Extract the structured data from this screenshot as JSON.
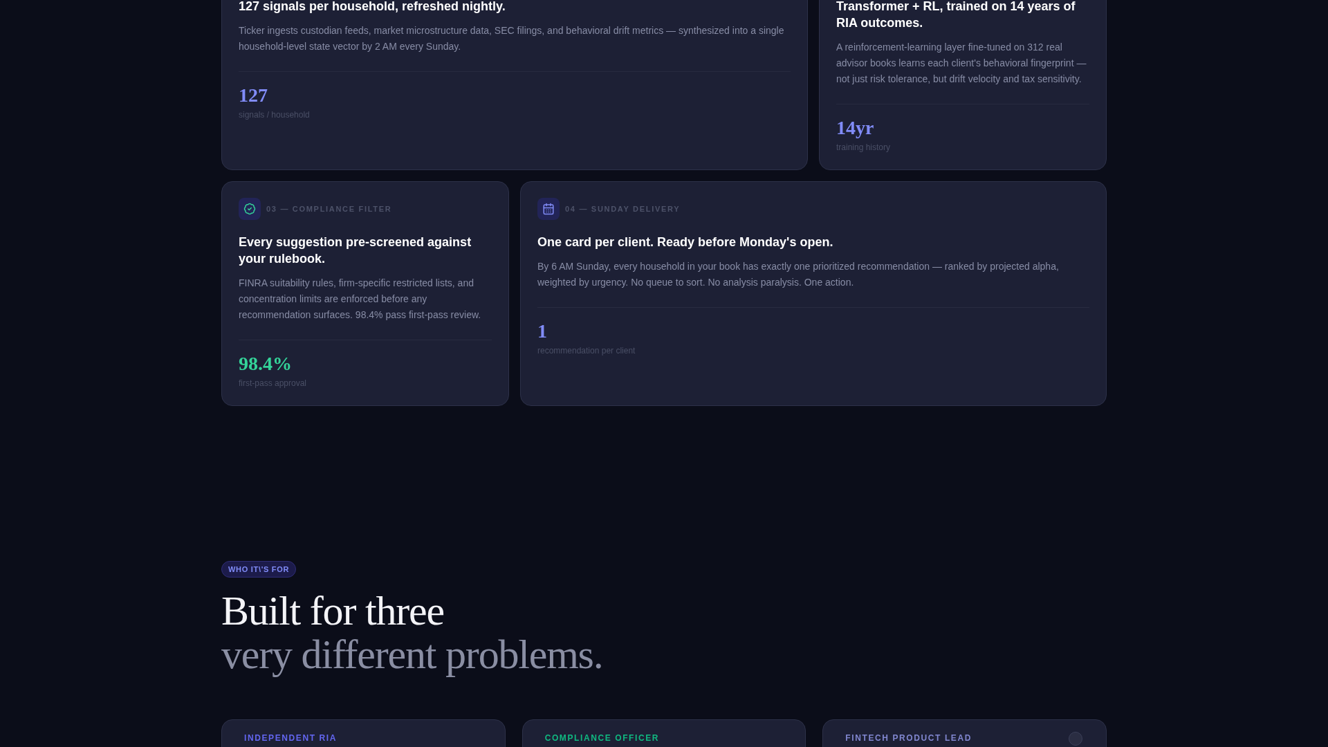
{
  "features": [
    {
      "title": "127 signals per household, refreshed nightly.",
      "body": "Ticker ingests custodian feeds, market microstructure data, SEC filings, and behavioral drift metrics — synthesized into a single household-level state vector by 2 AM every Sunday.",
      "stat": {
        "value": "127",
        "label": "signals / household",
        "color": "#818cf8"
      }
    },
    {
      "title": "Transformer + RL, trained on 14 years of RIA outcomes.",
      "body": "A reinforcement-learning layer fine-tuned on 312 real advisor books learns each client's behavioral fingerprint — not just risk tolerance, but drift velocity and tax sensitivity.",
      "stat": {
        "value": "14yr",
        "label": "training history",
        "color": "#818cf8"
      }
    },
    {
      "label": "03 — COMPLIANCE FILTER",
      "title": "Every suggestion pre-screened against your rulebook.",
      "body": "FINRA suitability rules, firm-specific restricted lists, and concentration limits are enforced before any recommendation surfaces. 98.4% pass first-pass review.",
      "stat": {
        "value": "98.4%",
        "label": "first-pass approval",
        "color": "#34d399"
      }
    },
    {
      "label": "04 — SUNDAY DELIVERY",
      "title": "One card per client. Ready before Monday's open.",
      "body": "By 6 AM Sunday, every household in your book has exactly one prioritized recommendation — ranked by projected alpha, weighted by urgency. No queue to sort. No analysis paralysis. One action.",
      "stat": {
        "value": "1",
        "label": "recommendation per client",
        "color": "#818cf8"
      }
    }
  ],
  "audience": {
    "badge": "WHO IT\\'S FOR",
    "heading": "Built for three",
    "subheading": "very different problems.",
    "cards": [
      {
        "label": "INDEPENDENT RIA",
        "color": "#6366f1",
        "has_icon": false
      },
      {
        "label": "COMPLIANCE OFFICER",
        "color": "#10b981",
        "has_icon": false
      },
      {
        "label": "FINTECH PRODUCT LEAD",
        "color": "#8187d0",
        "has_icon": true
      }
    ]
  }
}
